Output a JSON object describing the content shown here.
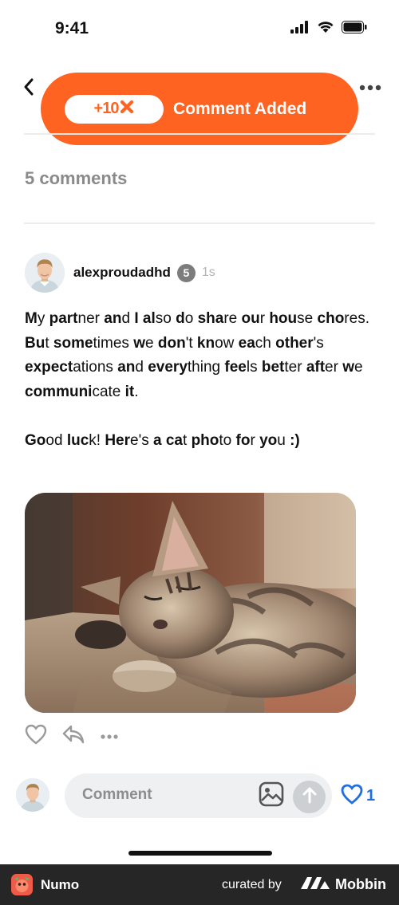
{
  "status_bar": {
    "time": "9:41",
    "icons": [
      "cellular-signal-icon",
      "wifi-icon",
      "battery-icon"
    ]
  },
  "header": {
    "back_icon": "chevron-left-icon",
    "more_icon": "more-horizontal-icon"
  },
  "toast": {
    "badge_text": "+10",
    "badge_icon": "x-mark-icon",
    "message": "Comment Added",
    "color": "#ff6321"
  },
  "comments_count_label": "5 comments",
  "comment": {
    "author": "alexproudadhd",
    "level": "5",
    "time_ago": "1s",
    "paragraphs": [
      [
        {
          "t": "M",
          "b": true
        },
        {
          "t": "y ",
          "b": false
        },
        {
          "t": "part",
          "b": true
        },
        {
          "t": "ner ",
          "b": false
        },
        {
          "t": "an",
          "b": true
        },
        {
          "t": "d ",
          "b": false
        },
        {
          "t": "I ",
          "b": true
        },
        {
          "t": "al",
          "b": true
        },
        {
          "t": "so ",
          "b": false
        },
        {
          "t": "d",
          "b": true
        },
        {
          "t": "o ",
          "b": false
        },
        {
          "t": "sha",
          "b": true
        },
        {
          "t": "re ",
          "b": false
        },
        {
          "t": "ou",
          "b": true
        },
        {
          "t": "r ",
          "b": false
        },
        {
          "t": "hou",
          "b": true
        },
        {
          "t": "se ",
          "b": false
        },
        {
          "t": "cho",
          "b": true
        },
        {
          "t": "res. ",
          "b": false
        },
        {
          "t": "Bu",
          "b": true
        },
        {
          "t": "t ",
          "b": false
        },
        {
          "t": "some",
          "b": true
        },
        {
          "t": "times ",
          "b": false
        },
        {
          "t": "w",
          "b": true
        },
        {
          "t": "e ",
          "b": false
        },
        {
          "t": "don",
          "b": true
        },
        {
          "t": "'t ",
          "b": false
        },
        {
          "t": "kn",
          "b": true
        },
        {
          "t": "ow ",
          "b": false
        },
        {
          "t": "ea",
          "b": true
        },
        {
          "t": "ch ",
          "b": false
        },
        {
          "t": "other",
          "b": true
        },
        {
          "t": "'s ",
          "b": false
        },
        {
          "t": "expect",
          "b": true
        },
        {
          "t": "ations ",
          "b": false
        },
        {
          "t": "an",
          "b": true
        },
        {
          "t": "d ",
          "b": false
        },
        {
          "t": "every",
          "b": true
        },
        {
          "t": "thing ",
          "b": false
        },
        {
          "t": "fee",
          "b": true
        },
        {
          "t": "ls ",
          "b": false
        },
        {
          "t": "bet",
          "b": true
        },
        {
          "t": "ter ",
          "b": false
        },
        {
          "t": "aft",
          "b": true
        },
        {
          "t": "er ",
          "b": false
        },
        {
          "t": "w",
          "b": true
        },
        {
          "t": "e ",
          "b": false
        },
        {
          "t": "communi",
          "b": true
        },
        {
          "t": "cate ",
          "b": false
        },
        {
          "t": "it",
          "b": true
        },
        {
          "t": ".",
          "b": false
        }
      ],
      [
        {
          "t": "Go",
          "b": true
        },
        {
          "t": "od ",
          "b": false
        },
        {
          "t": "luc",
          "b": true
        },
        {
          "t": "k! ",
          "b": false
        },
        {
          "t": "Her",
          "b": true
        },
        {
          "t": "e's ",
          "b": false
        },
        {
          "t": "a ",
          "b": true
        },
        {
          "t": "ca",
          "b": true
        },
        {
          "t": "t ",
          "b": false
        },
        {
          "t": "pho",
          "b": true
        },
        {
          "t": "to ",
          "b": false
        },
        {
          "t": "fo",
          "b": true
        },
        {
          "t": "r ",
          "b": false
        },
        {
          "t": "yo",
          "b": true
        },
        {
          "t": "u ",
          "b": false
        },
        {
          "t": ":)",
          "b": true
        }
      ]
    ],
    "image_subject": "sleeping tabby kitten"
  },
  "actions": {
    "like_icon": "heart-icon",
    "reply_icon": "reply-icon",
    "more_icon": "more-horizontal-icon"
  },
  "composer": {
    "placeholder": "Comment",
    "image_icon": "image-icon",
    "send_icon": "arrow-up-icon",
    "like_icon": "heart-icon",
    "like_count": "1"
  },
  "footer": {
    "app_name": "Numo",
    "curated_by": "curated by",
    "brand": "Mobbin"
  }
}
